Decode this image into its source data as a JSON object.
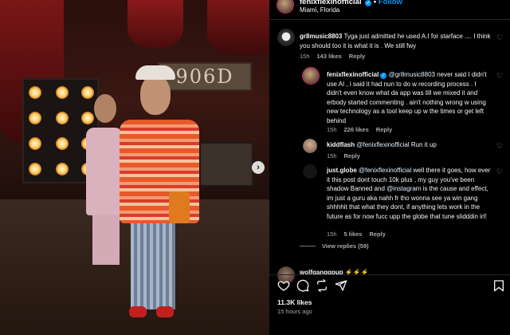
{
  "post": {
    "author": "fenixflexinofficial",
    "follow_separator": "•",
    "follow_label": "Follow",
    "location": "Miami, Florida",
    "likes": "11.3K likes",
    "time_ago": "15 hours ago",
    "sign_text": "906D"
  },
  "comments": [
    {
      "username": "gr8music8803",
      "text": "Tyga just admitted he used A.I for starface .... I think you should too it is what it is . We still fwy",
      "age": "15h",
      "likes": "143 likes",
      "reply_label": "Reply"
    },
    {
      "username": "fenixflexinofficial",
      "mention": "@gr8music8803",
      "text": "never said I didn't use AI , i said it had nun to do w recording process . I didn't even know what da app was till we mixed it and erbody started commenting . ain't nothing wrong w using new technology as a tool keep up w the times or get left behind",
      "age": "15h",
      "likes": "226 likes",
      "reply_label": "Reply"
    },
    {
      "username": "kiddflash",
      "mention": "@fenixflexinofficial",
      "text": "Run it up",
      "age": "15h",
      "reply_label": "Reply"
    },
    {
      "username": "just.globe",
      "mention": "@fenixflexinofficial",
      "text_a": "well there it goes, how ever it this post dont touch 10k plus , my guy you've been shadow Banned and",
      "mention2": "@instagram",
      "text_b": "is the cause and effect, im just a guru aka nahh fr tho wonna see ya win gang shhhhit that what they dont, if anything lets work in the future as for now fucc upp the globe that tune slidddin irl!",
      "age": "15h",
      "likes": "5 likes",
      "reply_label": "Reply"
    }
  ],
  "view_replies": "View replies (59)",
  "partial_comment": {
    "username": "wolfganggpup",
    "text": "⚡⚡⚡"
  },
  "colors": {
    "accent": "#0095f6",
    "background": "#000000",
    "muted": "#a8a8a8"
  },
  "icons": [
    "heart-icon",
    "comment-icon",
    "share-icon",
    "send-icon",
    "bookmark-icon",
    "verified-badge-icon",
    "chevron-right-icon"
  ]
}
